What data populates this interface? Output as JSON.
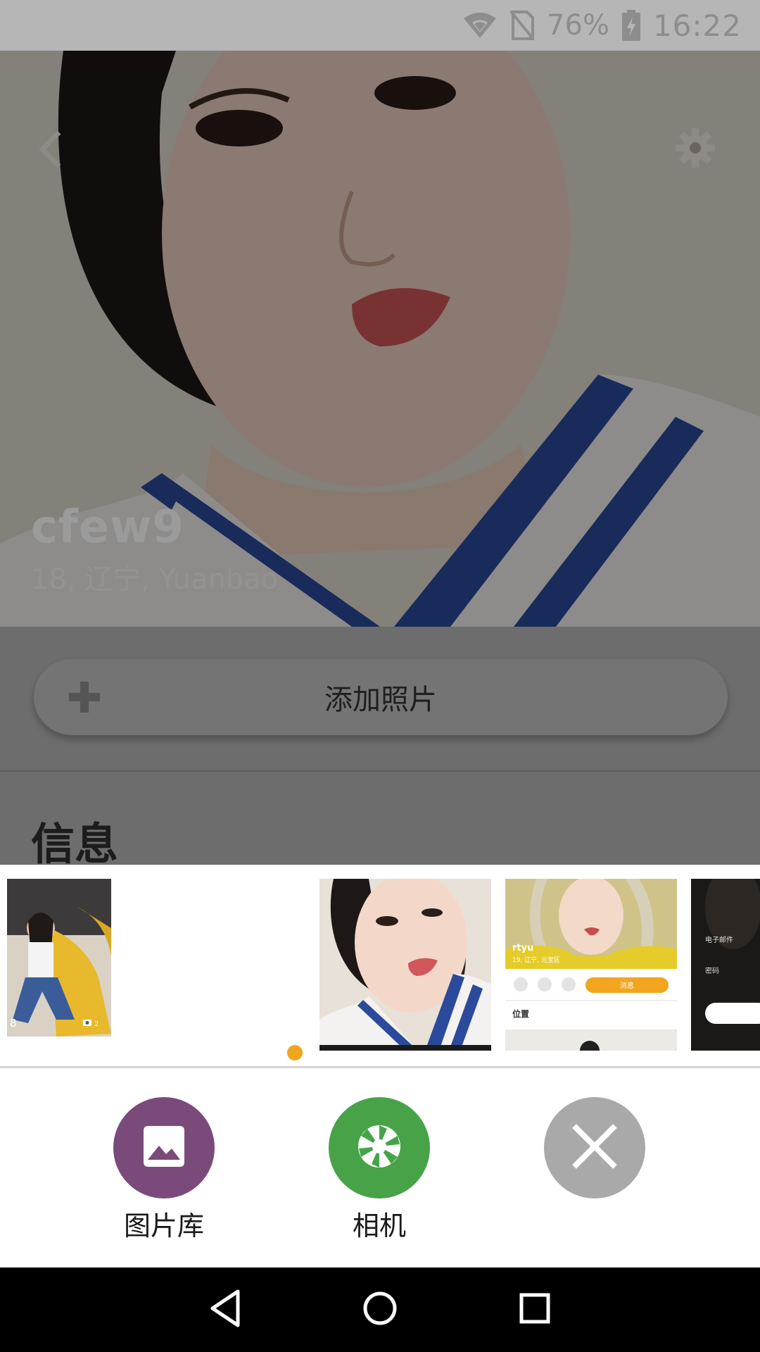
{
  "status_bar": {
    "battery": "76%",
    "time": "16:22",
    "icons": [
      "wifi-icon",
      "no-sim-icon",
      "battery-charging-icon"
    ]
  },
  "header": {
    "back_icon": "back-arrow-icon",
    "settings_icon": "gear-icon"
  },
  "profile": {
    "name": "cfew9",
    "meta": "18, 辽宁, Yuanbao"
  },
  "actions_bar": {
    "add_photo_label": "添加照片",
    "add_icon": "plus-icon"
  },
  "section": {
    "title": "信息"
  },
  "thumbnails": {
    "thumb1_count": "8",
    "thumb1_photos": "2",
    "thumb3_name": "rtyu",
    "thumb3_meta": "19, 辽宁, 元宝区",
    "thumb3_button": "消息",
    "thumb3_section": "位置",
    "thumb4_label_email": "电子邮件",
    "thumb4_label_password": "密码"
  },
  "picker": {
    "gallery_label": "图片库",
    "camera_label": "相机",
    "gallery_color": "#7a4a7a",
    "camera_color": "#48a348",
    "close_color": "#a9a9a9",
    "indicator_color": "#f2a51f"
  },
  "nav_bar": {
    "icons": [
      "back-triangle-icon",
      "home-circle-icon",
      "recents-square-icon"
    ]
  }
}
